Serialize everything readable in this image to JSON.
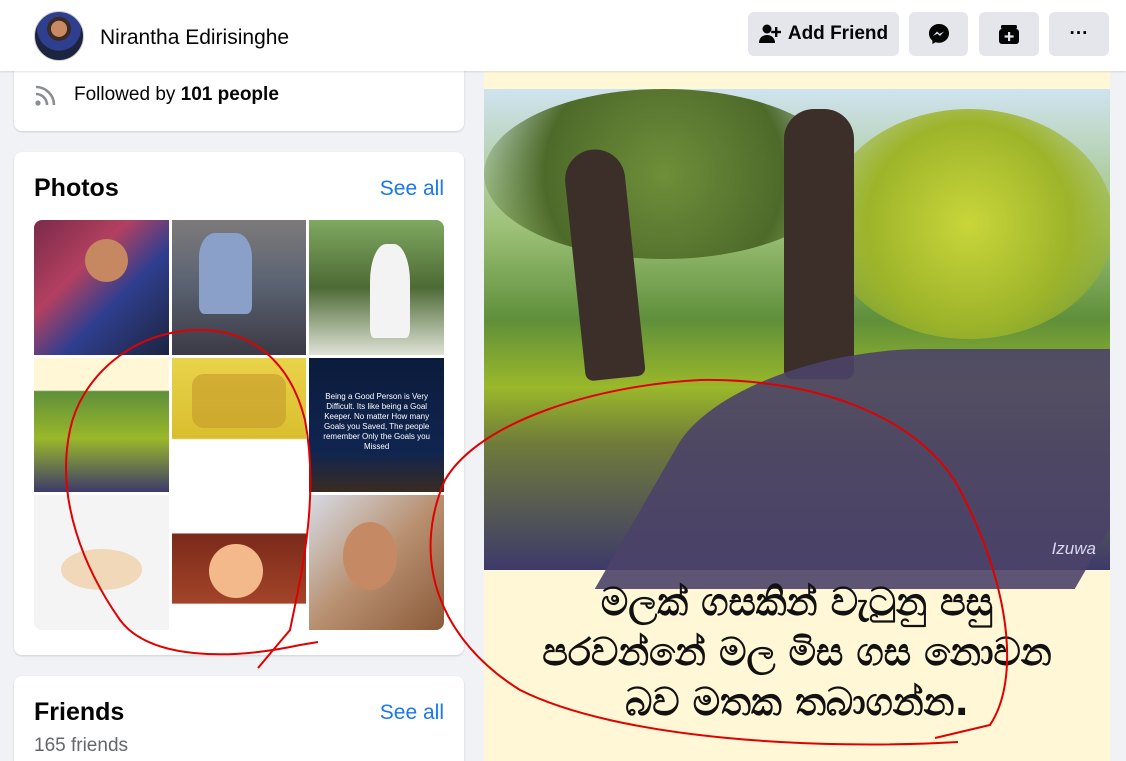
{
  "header": {
    "profile_name": "Nirantha Edirisinghe",
    "add_friend_label": "Add Friend",
    "more_label": "···"
  },
  "followers": {
    "prefix": "Followed by",
    "count": "101 people"
  },
  "photos": {
    "title": "Photos",
    "see_all": "See all",
    "tile6_text": "Being a Good Person is Very Difficult. Its like being a Goal Keeper. No matter How many Goals you Saved, The people remember Only the Goals you Missed"
  },
  "friends": {
    "title": "Friends",
    "see_all": "See all",
    "count": "165 friends"
  },
  "post": {
    "watermark": "Izuwa",
    "caption_lines": [
      "මලක් ගසකින් වැටුනු පසු",
      "පරවන්නේ මල මිස ගස නොවන",
      "බව මතක තබාගන්න."
    ]
  },
  "colors": {
    "link": "#1877f2",
    "button_bg": "#e4e6eb",
    "page_bg": "#f0f2f5",
    "annotation": "#e00000"
  }
}
